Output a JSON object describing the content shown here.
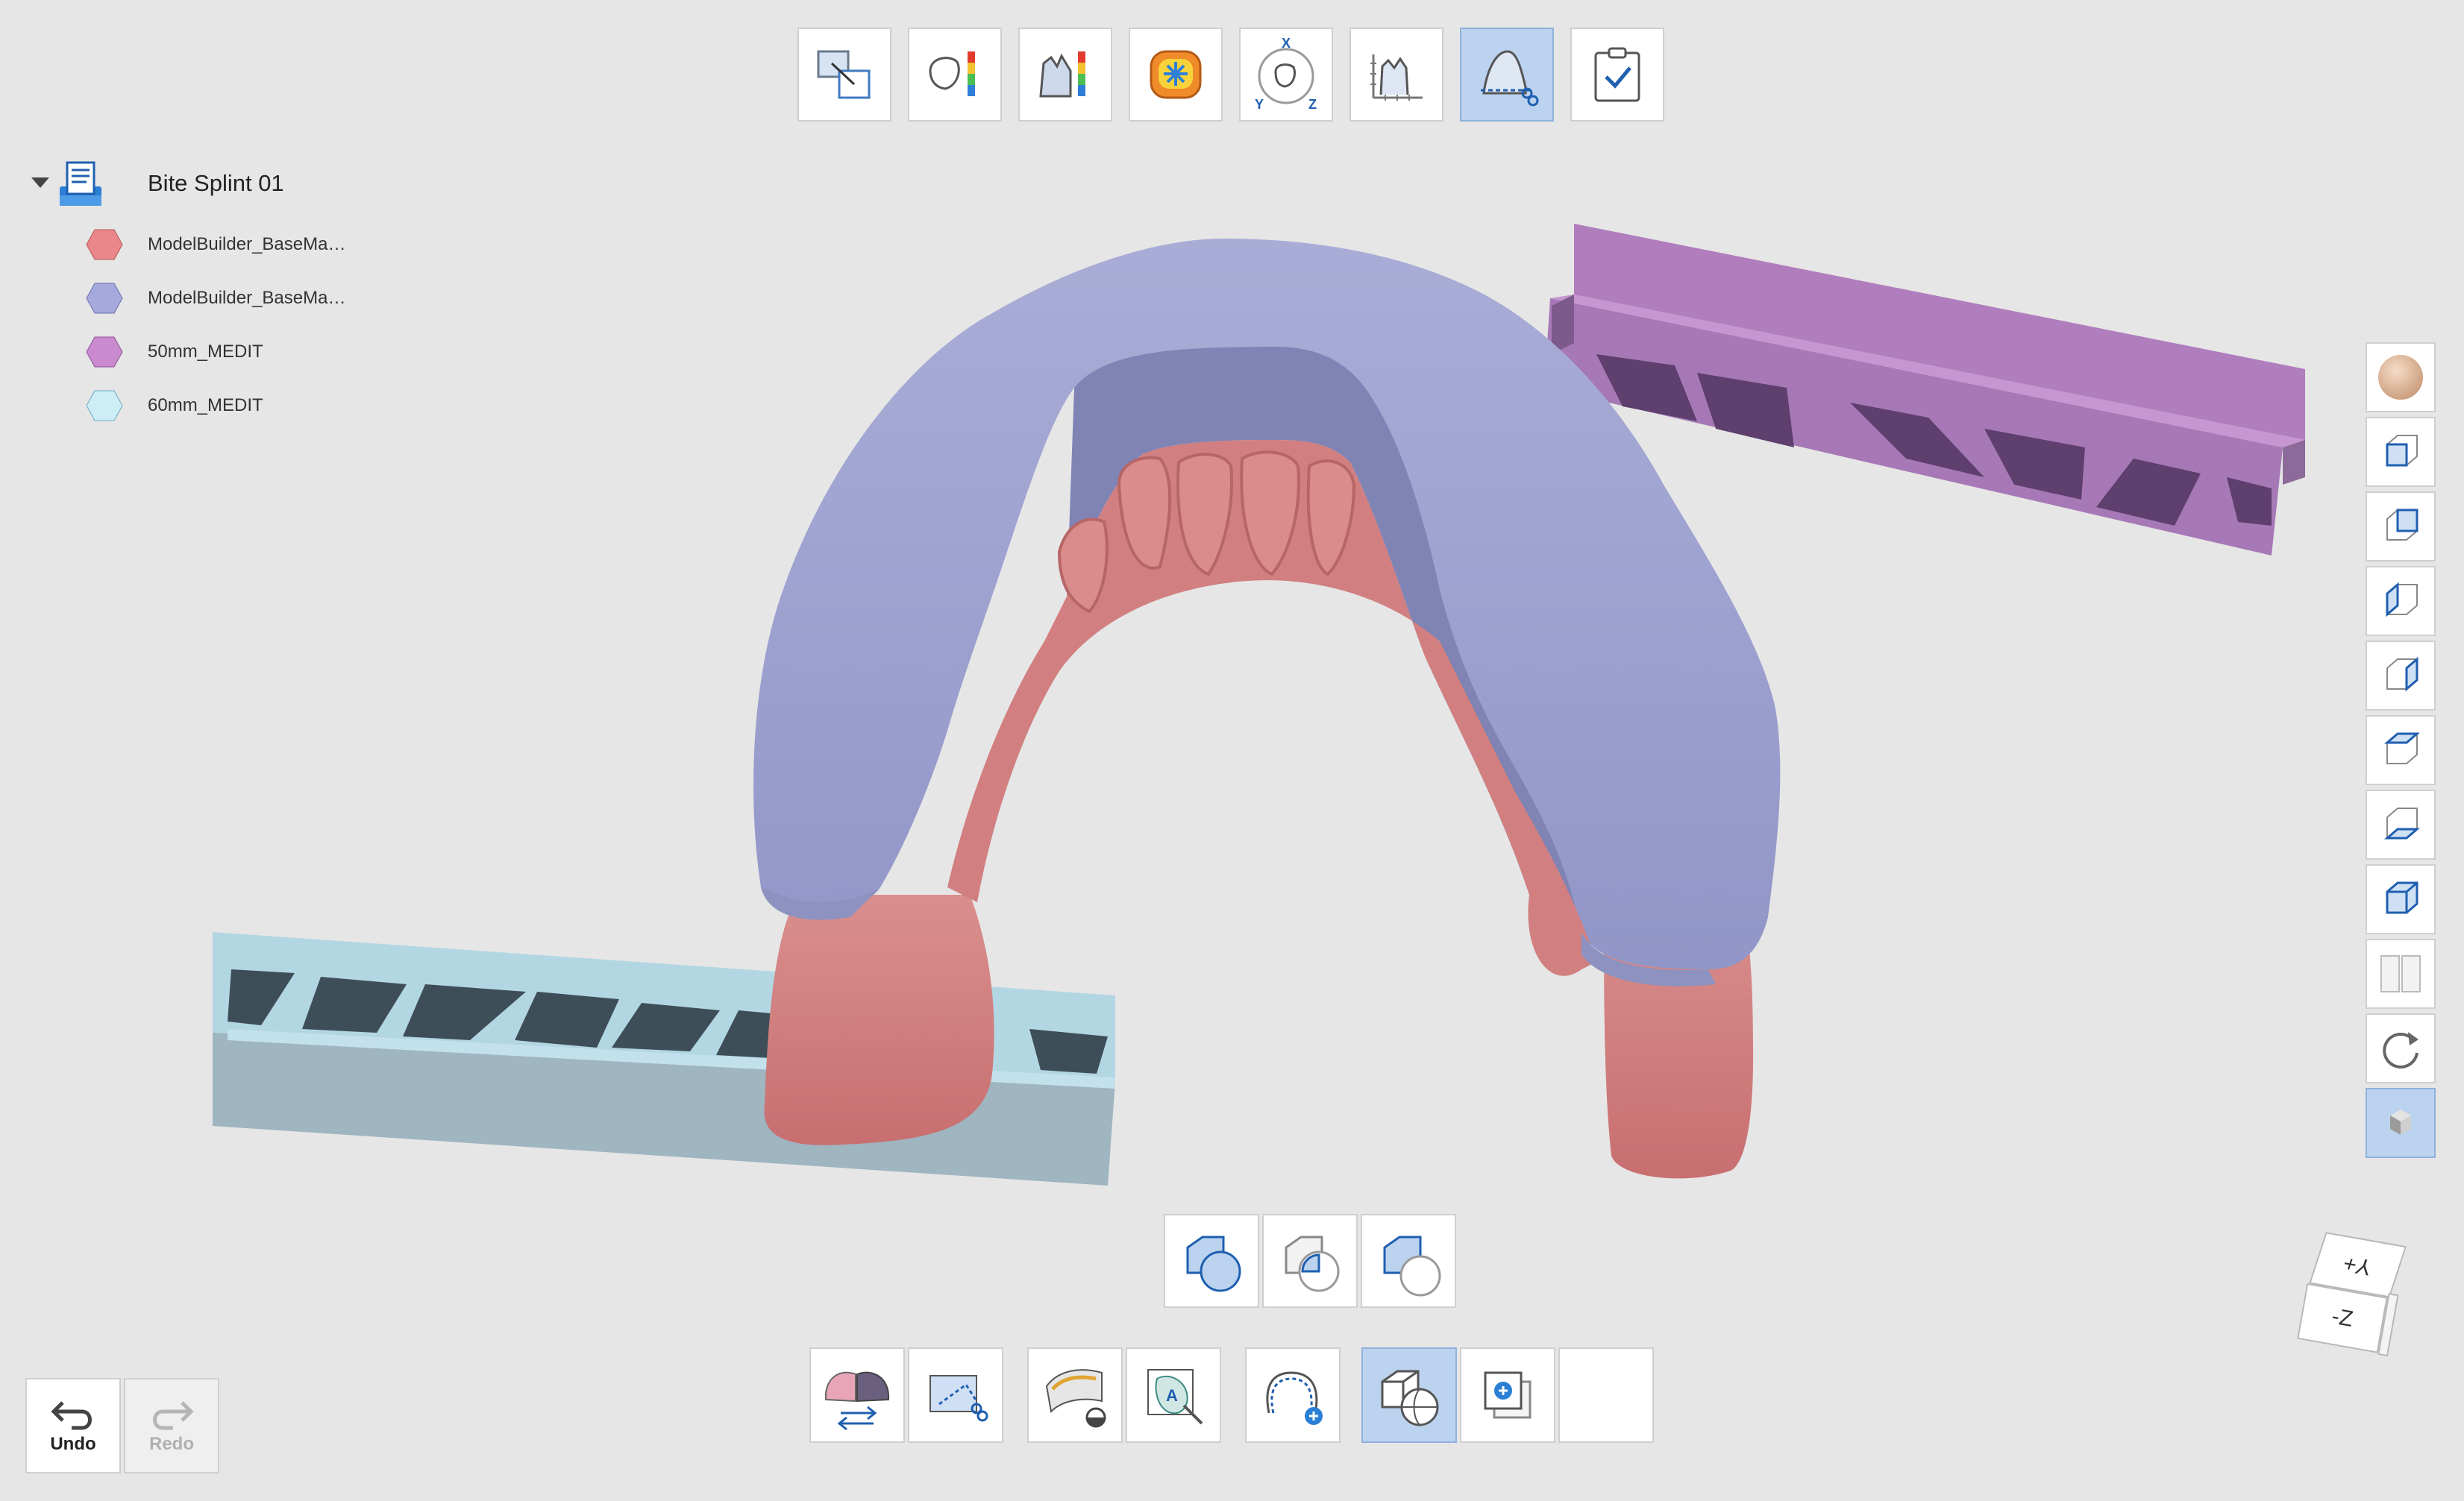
{
  "tree": {
    "root_label": "Bite Splint 01",
    "items": [
      {
        "label": "ModelBuilder_BaseMa…",
        "color": "#e9878a"
      },
      {
        "label": "ModelBuilder_BaseMa…",
        "color": "#a5a9dd"
      },
      {
        "label": "50mm_MEDIT",
        "color": "#c98ad0"
      },
      {
        "label": "60mm_MEDIT",
        "color": "#cdeef7"
      }
    ]
  },
  "top_toolbar": {
    "tools": [
      {
        "icon": "transform-icon"
      },
      {
        "icon": "thickness-map-icon"
      },
      {
        "icon": "section-map-icon"
      },
      {
        "icon": "occlusion-map-icon"
      },
      {
        "icon": "rotate-axis-icon",
        "axis_x": "X",
        "axis_y": "Y",
        "axis_z": "Z"
      },
      {
        "icon": "measure-icon"
      },
      {
        "icon": "trim-icon",
        "active": true
      },
      {
        "icon": "checklist-icon"
      }
    ]
  },
  "view_toolbar": {
    "items": [
      "material-icon",
      "front-view-icon",
      "back-view-icon",
      "left-view-icon",
      "right-view-icon",
      "top-view-icon",
      "bottom-view-icon",
      "iso-view-icon",
      "split-view-icon",
      "reset-view-icon",
      "box-view-icon"
    ]
  },
  "orientation_cube": {
    "top_face": "Y+",
    "front_face": "-Z"
  },
  "undo": {
    "label": "Undo"
  },
  "redo": {
    "label": "Redo"
  },
  "boolean_toolbar": {
    "items": [
      "union-icon",
      "subtract-icon",
      "intersect-icon"
    ]
  },
  "bottom_toolbar": {
    "items": [
      "swap-model-icon",
      "region-trim-icon",
      "offset-surface-icon",
      "label-text-icon",
      "add-margin-icon",
      "boolean-icon",
      "add-object-icon",
      "empty-slot"
    ]
  }
}
